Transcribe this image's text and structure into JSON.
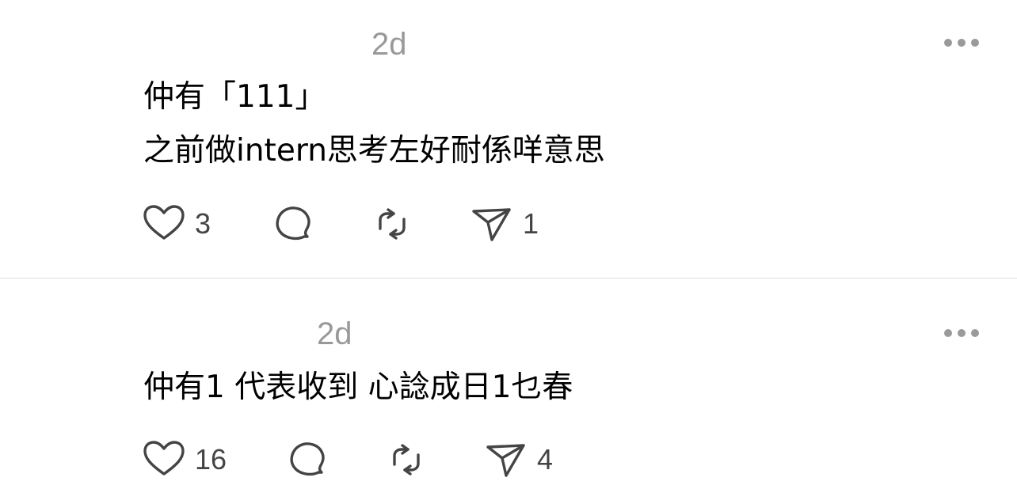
{
  "posts": [
    {
      "timestamp": "2d",
      "lines": [
        "仲有「111」",
        "之前做intern思考左好耐係咩意思"
      ],
      "likes": "3",
      "shares": "1"
    },
    {
      "timestamp": "2d",
      "lines": [
        "仲有1 代表收到 心諗成日1乜春"
      ],
      "likes": "16",
      "shares": "4"
    }
  ],
  "icons": {
    "like": "heart-icon",
    "reply": "comment-icon",
    "repost": "repost-icon",
    "share": "send-icon",
    "more": "more-icon"
  },
  "colors": {
    "icon_stroke": "#444444",
    "timestamp": "#999999",
    "more_dots": "#9a9a9a",
    "divider": "#dcdcdc"
  }
}
